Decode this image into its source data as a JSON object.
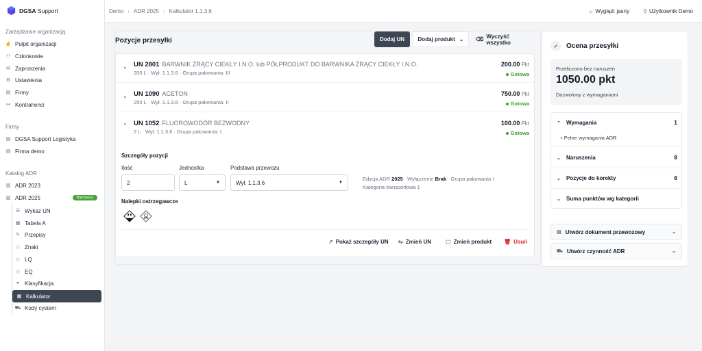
{
  "brand": {
    "name": "DGSA",
    "suffix": " Support"
  },
  "sidebar": {
    "org_section": "Zarządzanie organizacją",
    "org_items": [
      "Pulpit organizacji",
      "Członkowie",
      "Zaproszenia",
      "Ustawienia",
      "Firmy",
      "Kontrahenci"
    ],
    "firms_section": "Firmy",
    "firm_items": [
      "DGSA Support Logistyka",
      "Firma demo"
    ],
    "catalog_section": "Katalog ADR",
    "catalog_items": [
      "ADR 2023",
      "ADR 2025"
    ],
    "adr2025_badge": "Najnowsza",
    "adr2025_children": [
      "Wykaz UN",
      "Tabela A",
      "Przepisy",
      "Znaki",
      "LQ",
      "EQ",
      "Klasyfikacja",
      "Kalkulator",
      "Kody cystern"
    ],
    "active_item": "Kalkulator"
  },
  "topbar": {
    "breadcrumbs": [
      "Demo",
      "ADR 2025",
      "Kalkulator 1.1.3.6"
    ],
    "theme_label": "Wygląd: jasny",
    "user_label": "Użytkownik Demo"
  },
  "shipment": {
    "title": "Pozycje przesyłki",
    "add_un": "Dodaj UN",
    "add_product": "Dodaj produkt",
    "clear_all": "Wyczyść wszystko",
    "items": [
      {
        "un": "UN 2801",
        "name": "BARWNIK ŻRĄCY CIEKŁY I.N.O. lub PÓŁPRODUKT DO BARWNIKA ŻRĄCY CIEKŁY I.N.O.",
        "sub": "200 L · Wył. 1.1.3.6 · Grupa pakowania: III",
        "points": "200.00",
        "unit": "Pkt",
        "status": "Gotowa",
        "expanded": false
      },
      {
        "un": "UN 1090",
        "name": "ACETON",
        "sub": "250 L · Wył. 1.1.3.6 · Grupa pakowania: II",
        "points": "750.00",
        "unit": "Pkt",
        "status": "Gotowa",
        "expanded": false
      },
      {
        "un": "UN 1052",
        "name": "FLUOROWODÓR BEZWODNY",
        "sub": "2 L · Wył. 1.1.3.6 · Grupa pakowania: I",
        "points": "100.00",
        "unit": "Pkt",
        "status": "Gotowa",
        "expanded": true
      }
    ],
    "details": {
      "title": "Szczegóły pozycji",
      "qty_label": "Ilość",
      "qty_value": "2",
      "unit_label": "Jednostka",
      "unit_value": "L",
      "basis_label": "Podstawa przewozu",
      "basis_value": "Wył. 1.1.3.6",
      "edition_label": "Edycja ADR",
      "edition_value": "2025",
      "exclusion_label": "Wyłączenie",
      "exclusion_value": "Brak",
      "pg_label": "Grupa pakowania",
      "pg_value": "I",
      "transport_cat_label": "Kategoria transportowa",
      "transport_cat_value": "1",
      "labels_title": "Nalepki ostrzegawcze",
      "actions": {
        "show_details": "Pokaż szczegóły UN",
        "change_un": "Zmień UN",
        "change_product": "Zmień produkt",
        "remove": "Usuń"
      }
    }
  },
  "assessment": {
    "title": "Ocena przesyłki",
    "calc_text": "Przeliczono bez naruszeń",
    "total": "1050.00 pkt",
    "allowed_text": "Dozwolony z wymaganiami",
    "sections": [
      {
        "label": "Wymagania",
        "count": "1",
        "expanded": true,
        "bullet": "Pełne wymagania ADR"
      },
      {
        "label": "Naruszenia",
        "count": "0"
      },
      {
        "label": "Pozycje do korekty",
        "count": "0"
      },
      {
        "label": "Suma punktów wg kategorii",
        "count": ""
      }
    ],
    "create_doc": "Utwórz dokument przewozowy",
    "create_task": "Utwórz czynność ADR"
  },
  "colors": {
    "accent_dark": "#3f4653",
    "ok_green": "#3f9a2f",
    "badge_green": "#4aa33a",
    "danger_red": "#dc2626"
  }
}
